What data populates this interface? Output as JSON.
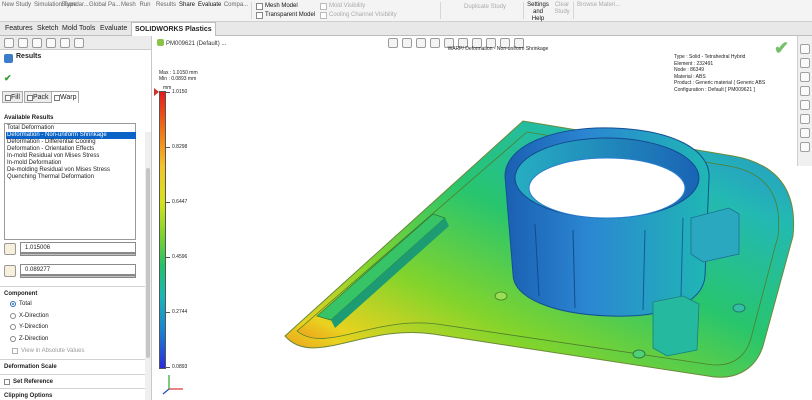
{
  "ribbon": {
    "items": [
      {
        "label": "New Study",
        "dark": false
      },
      {
        "label": "Simulation Type",
        "dark": false
      },
      {
        "label": "Boundar...",
        "dark": false
      },
      {
        "label": "Global Pa...",
        "dark": false
      },
      {
        "label": "Mesh",
        "dark": false
      },
      {
        "label": "Run",
        "dark": false
      },
      {
        "label": "Results",
        "dark": false
      },
      {
        "label": "Share",
        "dark": true
      },
      {
        "label": "Evaluate",
        "dark": true
      },
      {
        "label": "Compa...",
        "dark": false
      }
    ],
    "mesh_model": "Mesh Model",
    "transparent_model": "Transparent Model",
    "mold_visibility": "Mold Visibility",
    "cooling_channel_visibility": "Cooling Channel Visibility",
    "duplicate_study": "Duplicate Study",
    "settings_help": "Settings and Help",
    "clear_study": "Clear Study",
    "browse_material": "Browse Materi..."
  },
  "tabs": [
    "Features",
    "Sketch",
    "Mold Tools",
    "Evaluate",
    "SOLIDWORKS Plastics"
  ],
  "panel": {
    "title": "Results",
    "subtabs": [
      "Fill",
      "Pack",
      "Warp"
    ],
    "available_results_label": "Available Results",
    "results": [
      "Total Deformation",
      "Deformation - Non-uniform Shrinkage",
      "Deformation - Differential Cooling",
      "Deformation - Orientation Effects",
      "In-mold Residual von Mises Stress",
      "In-mold Deformation",
      "De-molding Residual von Mises Stress",
      "Quenching Thermal Deformation"
    ],
    "selected_index": 1,
    "max_value": "1.015006",
    "min_value": "0.089277",
    "component_label": "Component",
    "components": [
      "Total",
      "X-Direction",
      "Y-Direction",
      "Z-Direction"
    ],
    "selected_component": 0,
    "absolute_values": "View in Absolute Values",
    "deformation_scale": "Deformation Scale",
    "set_reference": "Set Reference",
    "clipping_options": "Clipping Options"
  },
  "viewport": {
    "tree_label": "PM009621 (Default) ...",
    "caption": "WARP/ Deformation - Non-uniform Shrinkage",
    "info": [
      "Type : Solid - Tetrahedral Hybrid",
      "Element : 232491",
      "Node : 86349",
      "Material : ABS",
      "Product : Generic material ( Generic ABS",
      "Configuration : Default [ PM009621 ]"
    ],
    "max": "Max : 1.0150 mm",
    "min": "Min : 0.0893 mm",
    "unit": "mm",
    "ticks": [
      "1.0150",
      "0.8298",
      "0.6447",
      "0.4596",
      "0.2744",
      "0.0893"
    ],
    "colors": {
      "accent": "#0a64c8",
      "check": "#76c06b"
    }
  }
}
